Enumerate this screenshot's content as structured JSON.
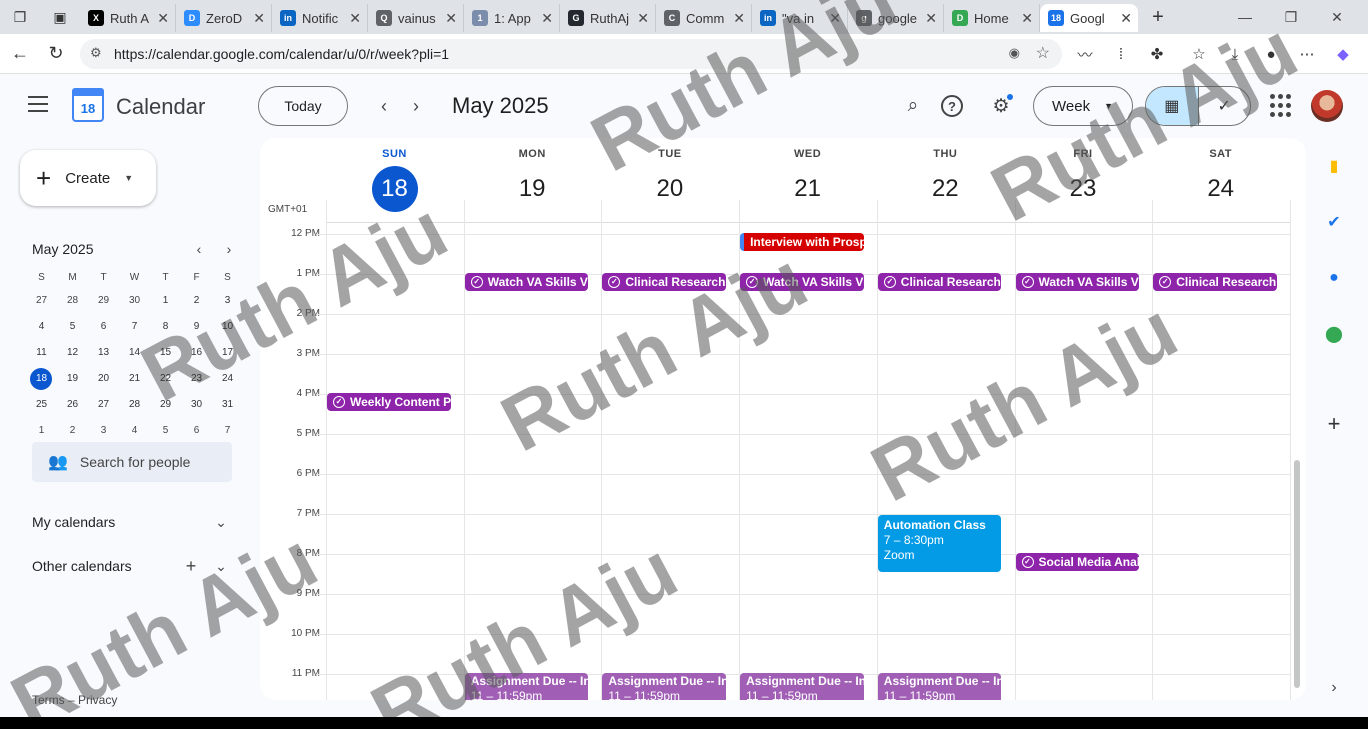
{
  "browser": {
    "tabs": [
      {
        "label": "Ruth A",
        "color": "#000000",
        "glyph": "X"
      },
      {
        "label": "ZeroD",
        "color": "#2d8cff",
        "glyph": "D"
      },
      {
        "label": "Notific",
        "color": "#0a66c2",
        "glyph": "in"
      },
      {
        "label": "vainus",
        "color": "#5f6368",
        "glyph": "Q"
      },
      {
        "label": "1: App",
        "color": "#7c8cab",
        "glyph": "1"
      },
      {
        "label": "RuthAj",
        "color": "#24292f",
        "glyph": "G"
      },
      {
        "label": "Comm",
        "color": "#5f6368",
        "glyph": "C"
      },
      {
        "label": "\"va in",
        "color": "#0a66c2",
        "glyph": "in"
      },
      {
        "label": "google",
        "color": "#5f6368",
        "glyph": "g"
      },
      {
        "label": "Home",
        "color": "#34a853",
        "glyph": "D"
      },
      {
        "label": "Googl",
        "color": "#1a73e8",
        "glyph": "18",
        "active": true
      }
    ],
    "url": "https://calendar.google.com/calendar/u/0/r/week?pli=1"
  },
  "header": {
    "app_name": "Calendar",
    "logo_day": "18",
    "today_label": "Today",
    "month_label": "May 2025",
    "view_label": "Week"
  },
  "sidebar": {
    "create_label": "Create",
    "mini_title": "May 2025",
    "dow": [
      "S",
      "M",
      "T",
      "W",
      "T",
      "F",
      "S"
    ],
    "weeks": [
      [
        "27",
        "28",
        "29",
        "30",
        "1",
        "2",
        "3"
      ],
      [
        "4",
        "5",
        "6",
        "7",
        "8",
        "9",
        "10"
      ],
      [
        "11",
        "12",
        "13",
        "14",
        "15",
        "16",
        "17"
      ],
      [
        "18",
        "19",
        "20",
        "21",
        "22",
        "23",
        "24"
      ],
      [
        "25",
        "26",
        "27",
        "28",
        "29",
        "30",
        "31"
      ],
      [
        "1",
        "2",
        "3",
        "4",
        "5",
        "6",
        "7"
      ]
    ],
    "selected_day": "18",
    "search_people": "Search for people",
    "my_calendars": "My calendars",
    "other_calendars": "Other calendars",
    "footer": "Terms – Privacy"
  },
  "week": {
    "timezone": "GMT+01",
    "days": [
      {
        "name": "SUN",
        "date": "18",
        "current": true
      },
      {
        "name": "MON",
        "date": "19"
      },
      {
        "name": "TUE",
        "date": "20"
      },
      {
        "name": "WED",
        "date": "21"
      },
      {
        "name": "THU",
        "date": "22"
      },
      {
        "name": "FRI",
        "date": "23"
      },
      {
        "name": "SAT",
        "date": "24"
      }
    ],
    "hours": [
      "12 PM",
      "1 PM",
      "2 PM",
      "3 PM",
      "4 PM",
      "5 PM",
      "6 PM",
      "7 PM",
      "8 PM",
      "9 PM",
      "10 PM",
      "11 PM"
    ],
    "events": [
      {
        "day": 3,
        "title": "Interview with Prosp",
        "style": "red",
        "start": 12.0,
        "task": false
      },
      {
        "day": 1,
        "title": "Watch VA Skills Vi",
        "style": "purple",
        "start": 13.0,
        "task": true
      },
      {
        "day": 2,
        "title": "Clinical Research",
        "style": "purple",
        "start": 13.0,
        "task": true
      },
      {
        "day": 3,
        "title": "Watch VA Skills Vi",
        "style": "purple",
        "start": 13.0,
        "task": true
      },
      {
        "day": 4,
        "title": "Clinical Research",
        "style": "purple",
        "start": 13.0,
        "task": true
      },
      {
        "day": 5,
        "title": "Watch VA Skills Vi",
        "style": "purple",
        "start": 13.0,
        "task": true
      },
      {
        "day": 6,
        "title": "Clinical Research",
        "style": "purple",
        "start": 13.0,
        "task": true
      },
      {
        "day": 0,
        "title": "Weekly Content P",
        "style": "purple",
        "start": 16.0,
        "task": true
      },
      {
        "day": 5,
        "title": "Social Media Anal",
        "style": "purple",
        "start": 20.0,
        "task": true
      },
      {
        "day": 4,
        "title": "Automation Class",
        "sub1": "7 – 8:30pm",
        "sub2": "Zoom",
        "style": "blue",
        "start": 19.0,
        "end": 20.5
      },
      {
        "day": 1,
        "title": "Assignment Due -- In",
        "sub1": "11 – 11:59pm",
        "style": "lpurple",
        "start": 23.0
      },
      {
        "day": 2,
        "title": "Assignment Due -- In",
        "sub1": "11 – 11:59pm",
        "style": "lpurple",
        "start": 23.0
      },
      {
        "day": 3,
        "title": "Assignment Due -- In",
        "sub1": "11 – 11:59pm",
        "style": "lpurple",
        "start": 23.0
      },
      {
        "day": 4,
        "title": "Assignment Due -- In",
        "sub1": "11 – 11:59pm",
        "style": "lpurple",
        "start": 23.0
      }
    ]
  },
  "watermark": "Ruth Aju",
  "colors": {
    "accent": "#0b57d0",
    "task_purple": "#8e24aa",
    "event_red": "#d50000",
    "event_blue": "#039be5"
  }
}
